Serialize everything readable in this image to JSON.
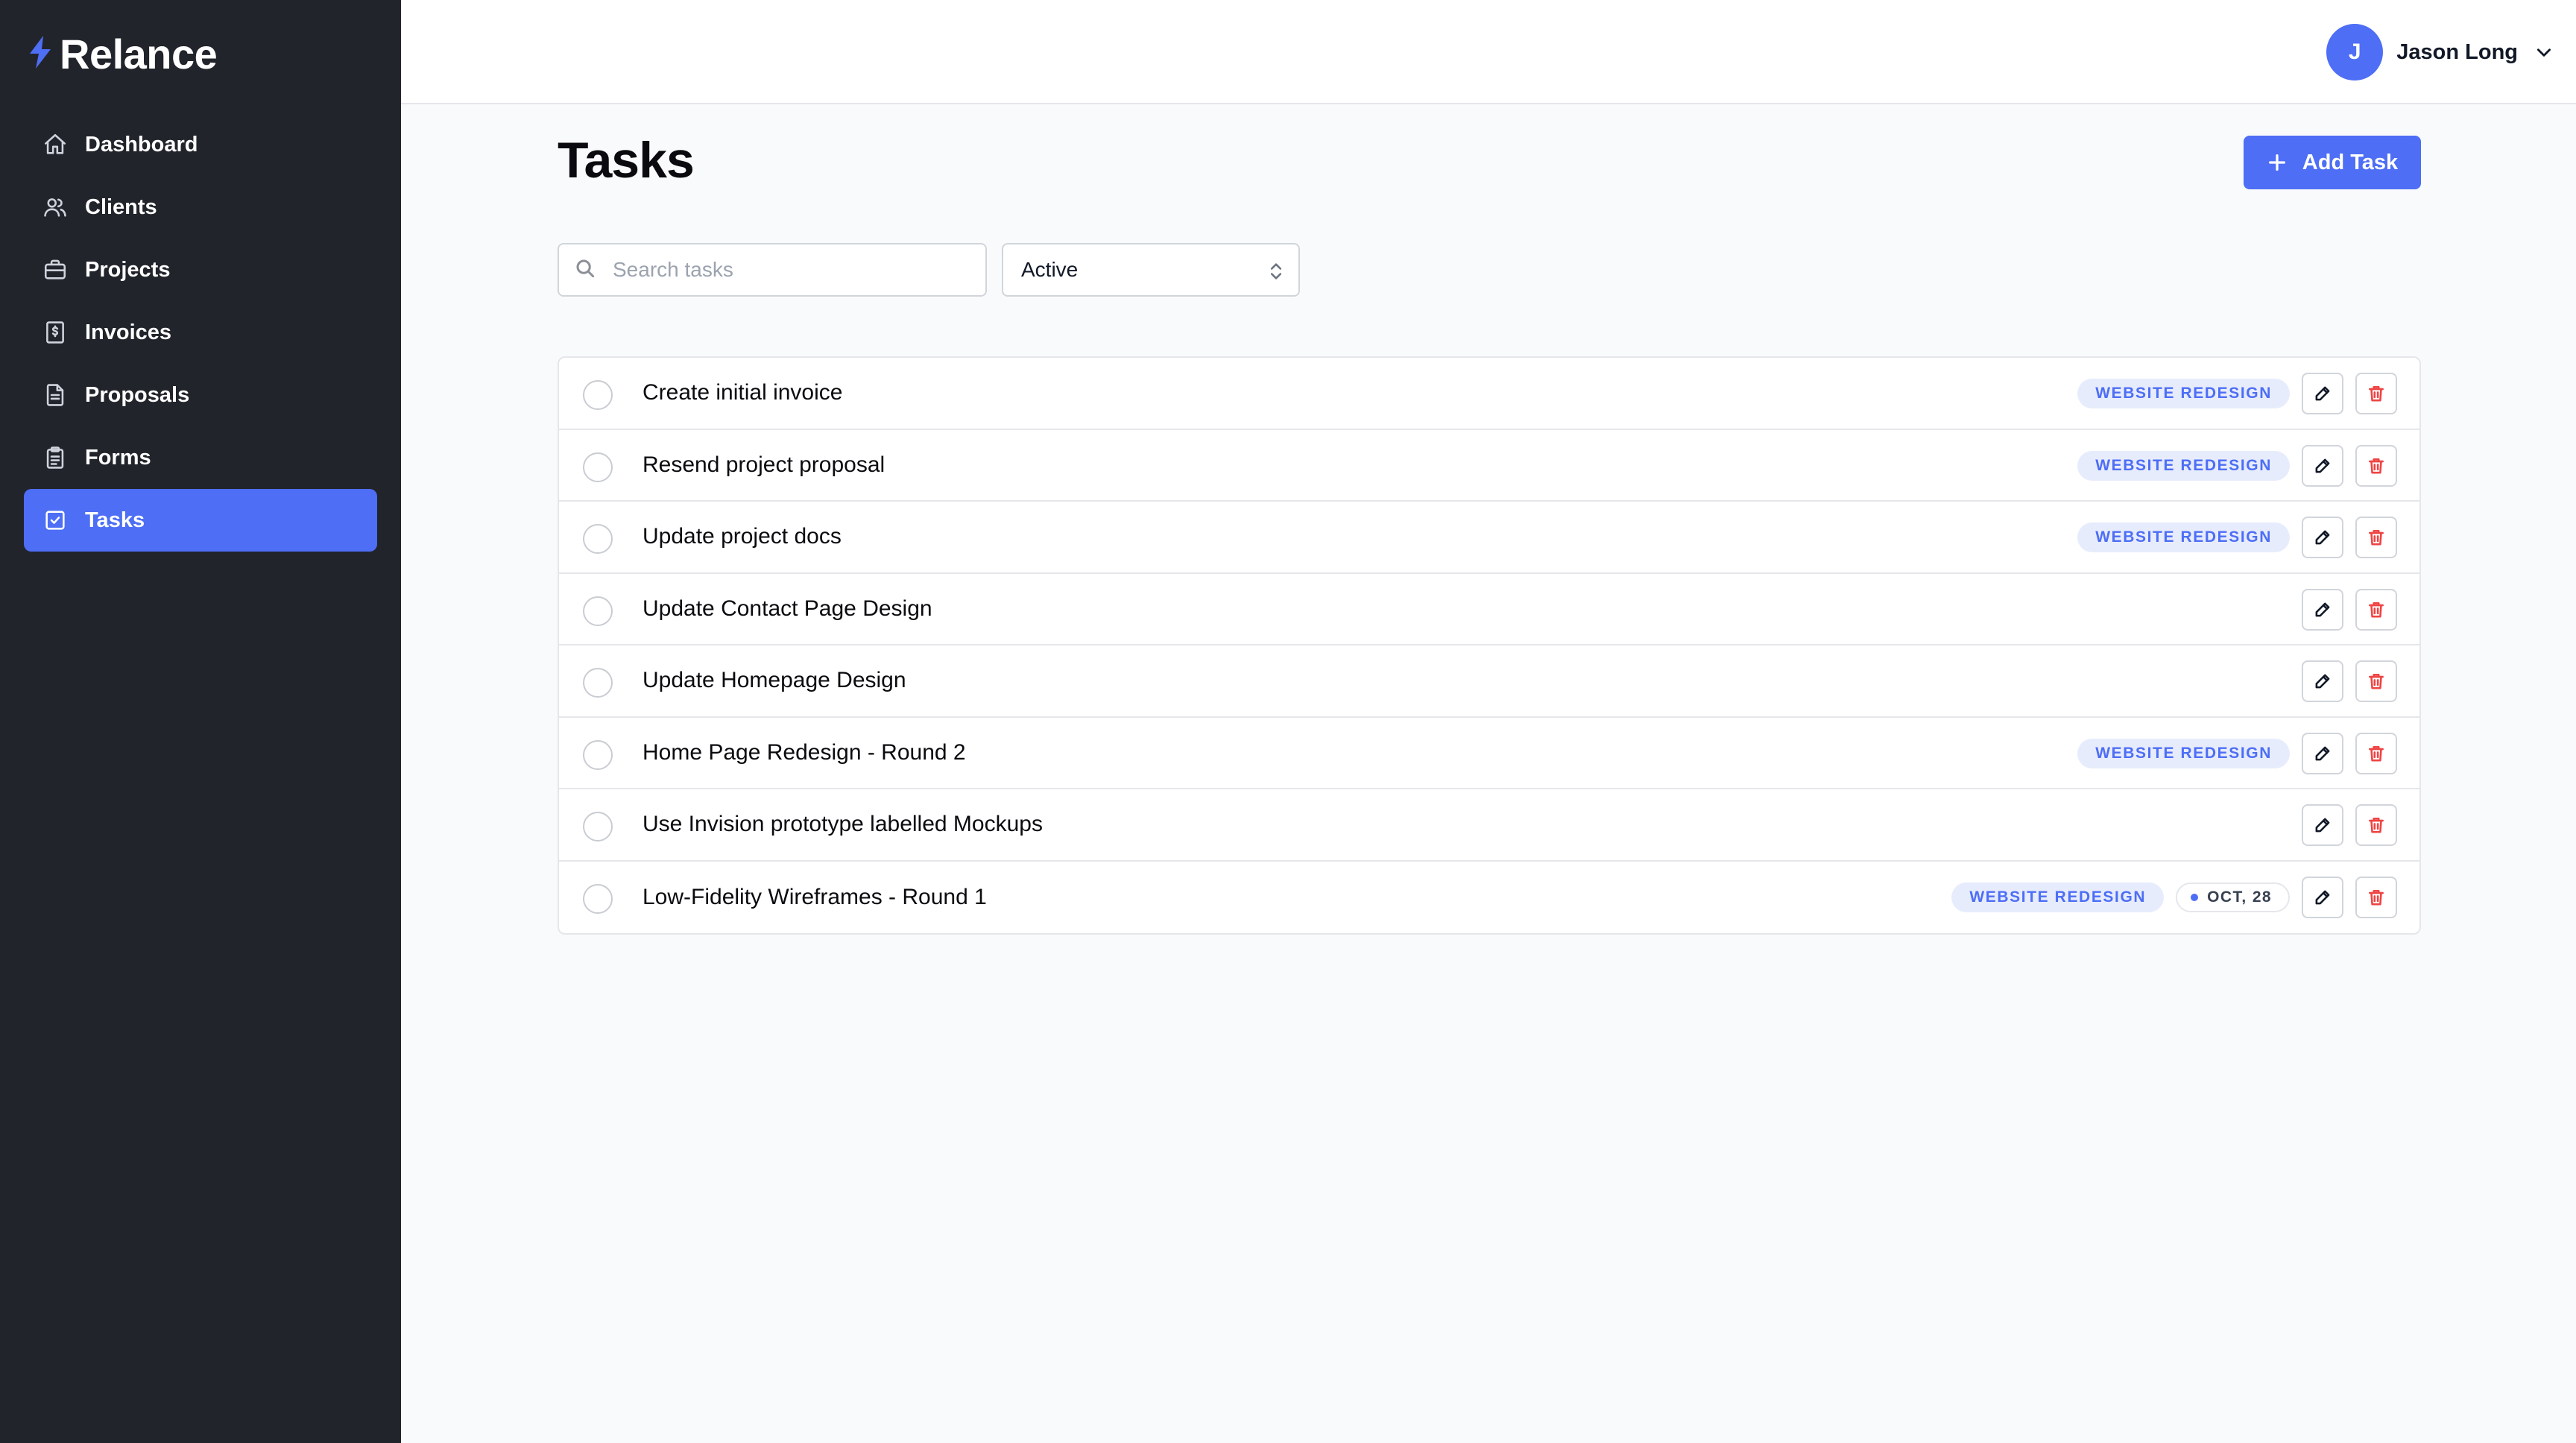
{
  "app": {
    "name": "Relance",
    "icon": "bolt-logo-icon"
  },
  "sidebar": {
    "items": [
      {
        "label": "Dashboard",
        "icon": "home-icon",
        "active": false
      },
      {
        "label": "Clients",
        "icon": "users-icon",
        "active": false
      },
      {
        "label": "Projects",
        "icon": "briefcase-icon",
        "active": false
      },
      {
        "label": "Invoices",
        "icon": "invoice-dollar-icon",
        "active": false
      },
      {
        "label": "Proposals",
        "icon": "document-icon",
        "active": false
      },
      {
        "label": "Forms",
        "icon": "clipboard-icon",
        "active": false
      },
      {
        "label": "Tasks",
        "icon": "check-square-icon",
        "active": true
      }
    ]
  },
  "header": {
    "user": {
      "initial": "J",
      "name": "Jason Long"
    }
  },
  "main": {
    "title": "Tasks",
    "add_button_label": "Add Task",
    "search": {
      "placeholder": "Search tasks",
      "value": ""
    },
    "filter": {
      "selected": "Active"
    }
  },
  "tasks": [
    {
      "title": "Create initial invoice",
      "project": "WEBSITE REDESIGN",
      "due": ""
    },
    {
      "title": "Resend project proposal",
      "project": "WEBSITE REDESIGN",
      "due": ""
    },
    {
      "title": "Update project docs",
      "project": "WEBSITE REDESIGN",
      "due": ""
    },
    {
      "title": "Update Contact Page Design",
      "project": "",
      "due": ""
    },
    {
      "title": "Update Homepage Design",
      "project": "",
      "due": ""
    },
    {
      "title": "Home Page Redesign - Round 2",
      "project": "WEBSITE REDESIGN",
      "due": ""
    },
    {
      "title": "Use Invision prototype labelled Mockups",
      "project": "",
      "due": ""
    },
    {
      "title": "Low-Fidelity Wireframes - Round 1",
      "project": "WEBSITE REDESIGN",
      "due": "OCT, 28"
    }
  ],
  "colors": {
    "accent": "#4d6ef5",
    "sidebar_bg": "#22242b",
    "badge_bg": "#e7ecfd",
    "danger": "#ef4444"
  }
}
